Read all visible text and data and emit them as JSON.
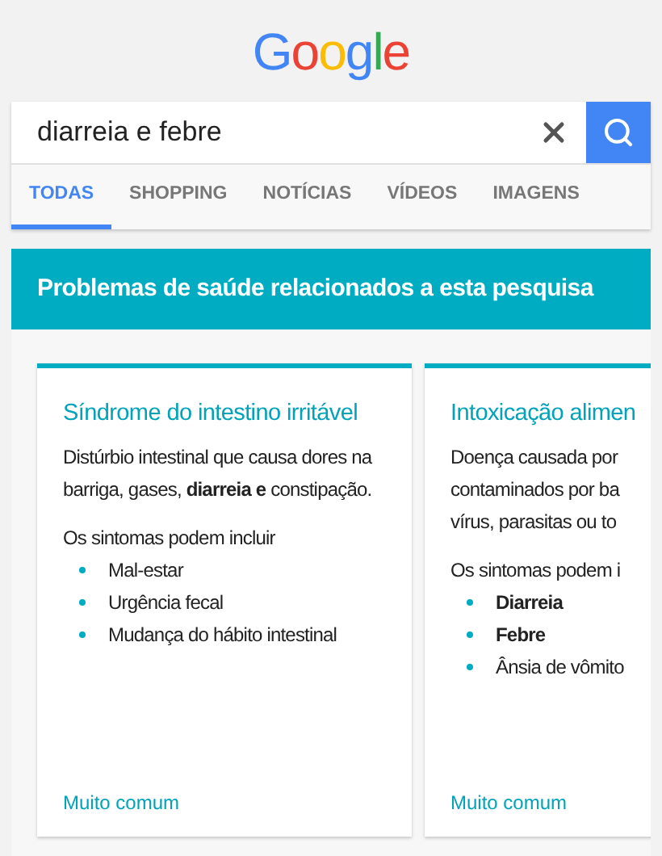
{
  "logo": "Google",
  "search": {
    "value": "diarreia e febre"
  },
  "tabs": [
    {
      "label": "TODAS",
      "selected": true
    },
    {
      "label": "SHOPPING",
      "selected": false
    },
    {
      "label": "NOTÍCIAS",
      "selected": false
    },
    {
      "label": "VÍDEOS",
      "selected": false
    },
    {
      "label": "IMAGENS",
      "selected": false
    }
  ],
  "panel": {
    "title": "Problemas de saúde relacionados a esta pesquisa",
    "cards": [
      {
        "title": "Síndrome do intestino irritável",
        "description_lines": [
          "Distúrbio intestinal que causa dores na barriga, gases, **diarreia e** constipação."
        ],
        "symptoms_intro": "Os sintomas podem incluir",
        "symptoms": [
          {
            "text": "Mal-estar",
            "bold": false
          },
          {
            "text": "Urgência fecal",
            "bold": false
          },
          {
            "text": "Mudança do hábito intestinal",
            "bold": false
          }
        ],
        "frequency": "Muito comum"
      },
      {
        "title": "Intoxicação alimen",
        "description_lines": [
          "Doença causada por",
          "contaminados por ba",
          "vírus, parasitas ou to"
        ],
        "symptoms_intro": "Os sintomas podem i",
        "symptoms": [
          {
            "text": "Diarreia",
            "bold": true
          },
          {
            "text": "Febre",
            "bold": true
          },
          {
            "text": "Ânsia de vômito",
            "bold": false
          }
        ],
        "frequency": "Muito comum"
      }
    ]
  }
}
